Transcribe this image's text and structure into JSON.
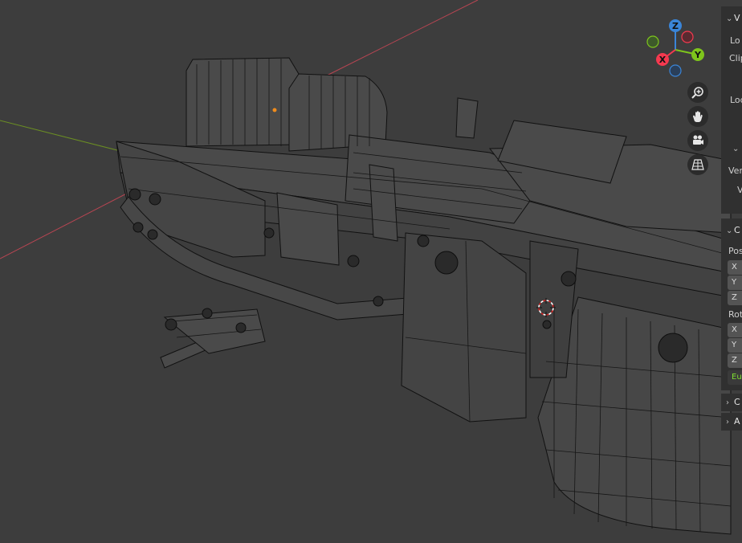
{
  "gizmo": {
    "z_label": "Z",
    "y_label": "Y",
    "x_label": "X",
    "colors": {
      "x": "#f5394f",
      "y": "#7ec51c",
      "z": "#3a85d8"
    }
  },
  "nav_buttons": [
    "zoom-icon",
    "pan-hand-icon",
    "camera-icon",
    "grid-perspective-icon"
  ],
  "sidebar": {
    "view_panel": {
      "header": "V",
      "lens_label": "Lo",
      "clip_label": "Clip",
      "local_label": "Loc"
    },
    "view_lock": {
      "header": "",
      "vertex_label": "Ver",
      "v_label": "V"
    },
    "cursor_panel": {
      "header": "C",
      "position_label": "Pos",
      "pos_x": "X",
      "pos_y": "Y",
      "pos_z": "Z",
      "rotation_label": "Rot",
      "rot_x": "X",
      "rot_y": "Y",
      "rot_z": "Z",
      "rotation_mode": "Eu"
    },
    "collections_panel": {
      "header": "C"
    },
    "annotations_panel": {
      "header": "A"
    }
  }
}
